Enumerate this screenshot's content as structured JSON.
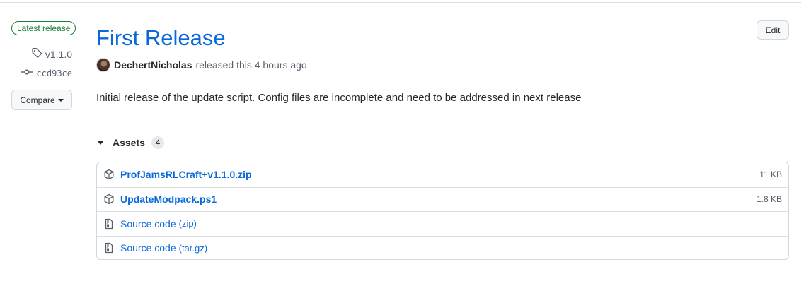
{
  "sidebar": {
    "latest_badge": "Latest release",
    "tag": "v1.1.0",
    "commit": "ccd93ce",
    "compare_label": "Compare"
  },
  "release": {
    "title": "First Release",
    "edit_label": "Edit",
    "author": "DechertNicholas",
    "released_text": "released this 4 hours ago",
    "description": "Initial release of the update script. Config files are incomplete and need to be addressed in next release"
  },
  "assets": {
    "label": "Assets",
    "count": "4",
    "items": [
      {
        "name": "ProfJamsRLCraft+v1.1.0.zip",
        "size": "11 KB",
        "icon": "package-icon"
      },
      {
        "name": "UpdateModpack.ps1",
        "size": "1.8 KB",
        "icon": "package-icon"
      },
      {
        "name": "Source code",
        "suffix": "(zip)",
        "icon": "file-zip-icon"
      },
      {
        "name": "Source code",
        "suffix": "(tar.gz)",
        "icon": "file-zip-icon"
      }
    ]
  },
  "colors": {
    "link": "#0969da",
    "latest_green": "#1a7f37",
    "muted": "#57606a",
    "border": "#d0d7de"
  }
}
